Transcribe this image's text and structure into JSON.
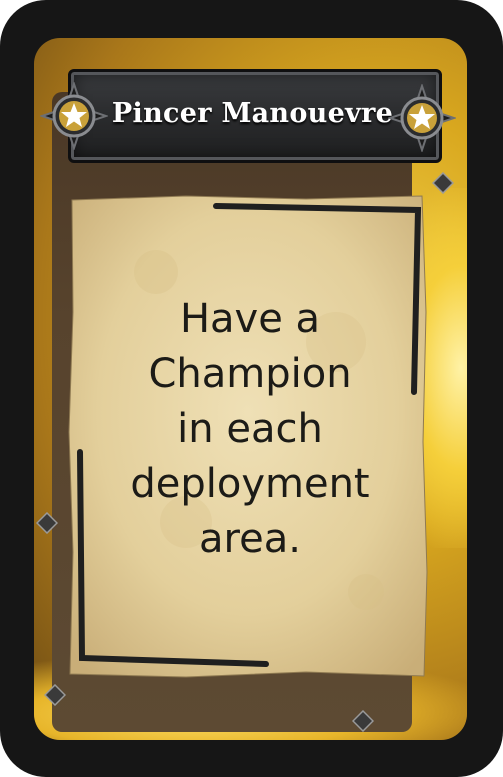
{
  "card": {
    "title": "Pincer Manouevre",
    "objective": "Have a Champion in each deployment area.",
    "objective_lines": [
      "Have a",
      "Champion",
      "in each",
      "deployment",
      "area."
    ]
  },
  "colors": {
    "frame": "#161616",
    "gold": "#e7b52a",
    "banner": "#2a2b2d",
    "parchment": "#e6d3a2",
    "text": "#1c1b17"
  },
  "icons": {
    "title_emblem": "star-icon",
    "corner_studs": "rivet-icon"
  }
}
